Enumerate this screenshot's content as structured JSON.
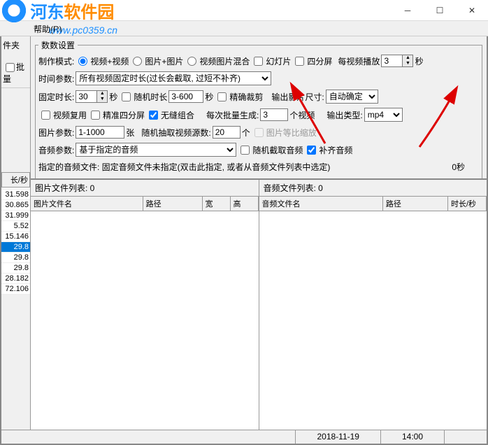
{
  "watermark": {
    "text1": "河东",
    "text2": "软件园",
    "url": "www.pc0359.cn"
  },
  "menu": {
    "help": "帮助(R)"
  },
  "left": {
    "label1": "件夹",
    "batch": "批量",
    "header": "长/秒",
    "rows": [
      "",
      "31.598",
      "30.865",
      "31.999",
      "5.52",
      "15.146",
      "29.8",
      "29.8",
      "29.8",
      "28.182",
      "72.106"
    ]
  },
  "params": {
    "legend": "数数设置",
    "mode_label": "制作模式:",
    "mode_video": "视频+视频",
    "mode_image": "图片+图片",
    "mode_mix": "视频图片混合",
    "mode_slide": "幻灯片",
    "mode_quad": "四分屏",
    "each_play": "每视频播放",
    "each_play_val": "3",
    "sec": "秒",
    "dur_param": "时间参数:",
    "dur_select": "所有视频固定时长(过长会截取, 过短不补齐)",
    "fixed_dur": "固定时长:",
    "fixed_dur_val": "30",
    "rand_dur": "随机时长",
    "rand_range": "3-600",
    "precise": "精确裁剪",
    "out_size": "输出影片尺寸:",
    "out_size_val": "自动确定",
    "reuse": "视频复用",
    "quad_precise": "精准四分屏",
    "seamless": "无缝组合",
    "batch_gen": "每次批量生成:",
    "batch_val": "3",
    "n_video": "个视频",
    "out_type": "输出类型:",
    "out_type_val": "mp4",
    "img_param": "图片参数:",
    "img_range": "1-1000",
    "sheet": "张",
    "rand_extract": "随机抽取视频源数:",
    "extract_val": "20",
    "ge": "个",
    "scale": "图片等比缩放",
    "audio_param": "音频参数:",
    "audio_based": "基于指定的音频",
    "rand_audio": "随机截取音频",
    "fill_audio": "补齐音频",
    "audio_spec": "指定的音频文件: 固定音频文件未指定(双击此指定, 或者从音频文件列表中选定)",
    "zero_sec": "0秒"
  },
  "lists": {
    "img_title": "图片文件列表: 0",
    "img_h1": "图片文件名",
    "img_h2": "路径",
    "img_h3": "宽",
    "img_h4": "高",
    "aud_title": "音频文件列表: 0",
    "aud_h1": "音频文件名",
    "aud_h2": "路径",
    "aud_h3": "时长/秒"
  },
  "status": {
    "date": "2018-11-19",
    "time": "14:00"
  }
}
